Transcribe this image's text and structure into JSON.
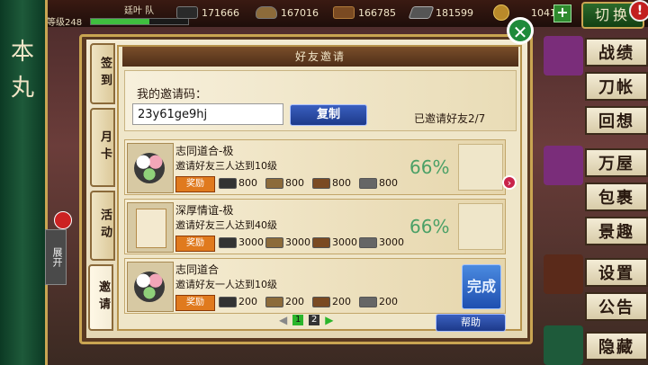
{
  "topbar": {
    "level_text": "等级",
    "level_value": "248",
    "level_progress": 0.6,
    "player_name": "廷叶 队",
    "resources": [
      {
        "icon": "charcoal-icon",
        "value": "171666"
      },
      {
        "icon": "whetstone-pot-icon",
        "value": "167016"
      },
      {
        "icon": "lumber-icon",
        "value": "166785"
      },
      {
        "icon": "steel-icon",
        "value": "181599"
      },
      {
        "icon": "gold-coin-icon",
        "value": "1041"
      }
    ],
    "plus_label": "+",
    "switch_label": "切换",
    "alert_label": "!"
  },
  "left_panel": {
    "vertical_title": "本 丸",
    "expand_label": "展开"
  },
  "right_menu": [
    {
      "label": "战绩"
    },
    {
      "label": "刀帐"
    },
    {
      "label": "回想"
    },
    {
      "label": "万屋"
    },
    {
      "label": "包裹"
    },
    {
      "label": "景趣"
    },
    {
      "label": "设置"
    },
    {
      "label": "公告"
    },
    {
      "label": "隐藏"
    }
  ],
  "modal": {
    "title": "好友邀请",
    "close_label": "✕",
    "side_tabs": [
      {
        "label": "签到",
        "active": false
      },
      {
        "label": "月卡",
        "active": false
      },
      {
        "label": "活动",
        "active": false
      },
      {
        "label": "邀请",
        "active": true
      }
    ],
    "invite_code_label": "我的邀请码：",
    "invite_code_value": "23y61ge9hj",
    "copy_label": "复制",
    "invited_count_text": "已邀请好友2/7",
    "rewards_tag": "奖励",
    "tasks": [
      {
        "title": "志同道合-极",
        "desc": "邀请好友三人达到10级",
        "rewards": [
          "800",
          "800",
          "800",
          "800"
        ],
        "progress_text": "66%",
        "completed": false,
        "thumb": "dango-icon"
      },
      {
        "title": "深厚情谊-极",
        "desc": "邀请好友三人达到40级",
        "rewards": [
          "3000",
          "3000",
          "3000",
          "3000"
        ],
        "progress_text": "66%",
        "completed": false,
        "thumb": "scroll-icon"
      },
      {
        "title": "志同道合",
        "desc": "邀请好友一人达到10级",
        "rewards": [
          "200",
          "200",
          "200",
          "200"
        ],
        "progress_text": "",
        "completed": true,
        "completed_label": "完成",
        "thumb": "dango-icon"
      }
    ],
    "pager": {
      "pages": [
        "1",
        "2"
      ],
      "current": "1"
    },
    "help_label": "帮助"
  }
}
